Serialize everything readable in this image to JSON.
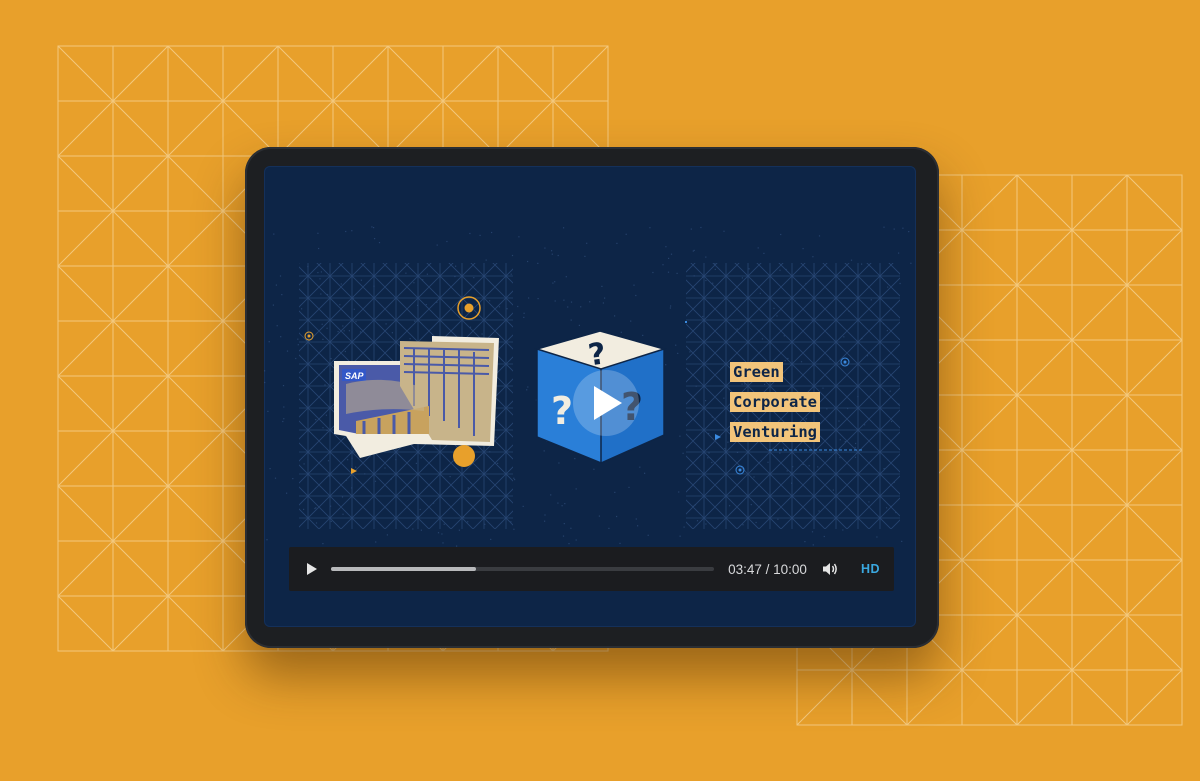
{
  "video": {
    "current_time": "03:47",
    "separator": " / ",
    "duration": "10:00",
    "progress_fraction": 0.378,
    "quality_badge": "HD"
  },
  "scene": {
    "title_lines": [
      "Green",
      "Corporate",
      "Venturing"
    ],
    "logo_text": "SAP",
    "mystery_glyph": "?"
  },
  "icons": {
    "play": "play-icon",
    "volume": "volume-icon",
    "center_play": "play-icon"
  },
  "colors": {
    "background": "#e8a02b",
    "screen": "#0d2547",
    "accent_orange": "#e8a02b",
    "highlight": "#f2c47a",
    "cube_blue": "#2a7fd8",
    "hd_blue": "#3aa8e0"
  }
}
